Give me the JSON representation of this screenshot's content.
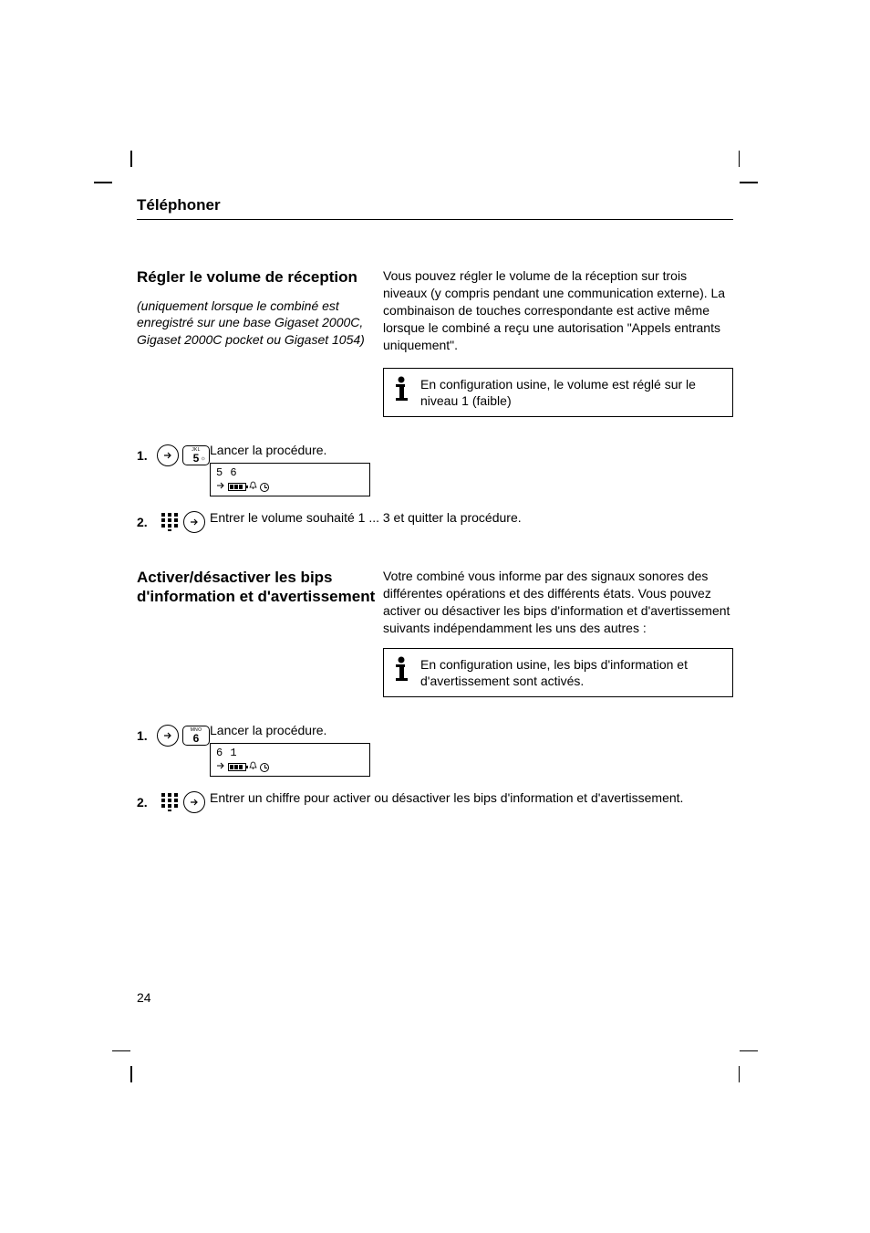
{
  "header": {
    "title": "Téléphoner"
  },
  "section1": {
    "heading": "Régler le volume de réception",
    "sub": "(uniquement lorsque le combiné est enregistré sur une base Gigaset 2000C, Gigaset 2000C pocket ou Gigaset 1054)",
    "intro": "Vous pouvez régler le volume de la réception sur trois niveaux (y compris pendant une communication externe). La combinaison de touches correspondante est active même lorsque le combiné a reçu une autorisation \"Appels entrants uniquement\".",
    "note": "En configuration usine, le volume est réglé sur le niveau 1 (faible)",
    "step1": {
      "text": "Lancer la procédure.",
      "lcd_line1": "5  6",
      "key_top": "JKL",
      "key_big": "5"
    },
    "step2": "Entrer le volume souhaité 1 ... 3 et quitter la procédure."
  },
  "section2": {
    "heading": "Activer/désactiver les bips d'information et d'avertissement",
    "intro": "Votre combiné vous informe par des signaux sonores des différentes opérations et des différents états. Vous pouvez activer ou désactiver les bips d'information et d'avertissement suivants indépendamment les uns des autres :",
    "note": "En configuration usine, les bips d'information et d'avertissement sont activés.",
    "step1": {
      "text": "Lancer la procédure.",
      "lcd_line1": "6  1",
      "key_top": "MNO",
      "key_big": "6"
    },
    "step2": "Entrer un chiffre pour activer ou désactiver les bips d'information et d'avertissement."
  },
  "page_number": "24"
}
